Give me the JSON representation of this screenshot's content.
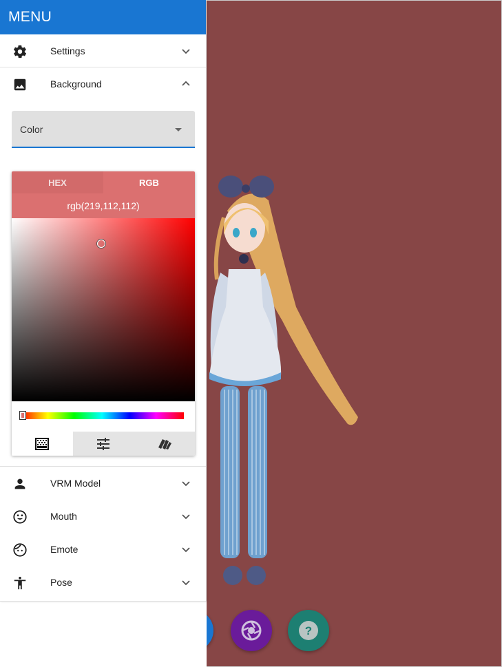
{
  "drawer": {
    "title": "MENU",
    "items": [
      {
        "label": "Settings",
        "icon": "gear-icon"
      },
      {
        "label": "Background",
        "icon": "image-icon",
        "expanded": true
      },
      {
        "label": "VRM Model",
        "icon": "person-icon"
      },
      {
        "label": "Mouth",
        "icon": "smiley-face-icon"
      },
      {
        "label": "Emote",
        "icon": "face-icon"
      },
      {
        "label": "Pose",
        "icon": "accessibility-icon"
      }
    ]
  },
  "background": {
    "select_value": "Color",
    "picker": {
      "tabs": [
        "HEX",
        "RGB"
      ],
      "active_tab": "RGB",
      "readout": "rgb(219,112,112)",
      "modes": [
        "palette-icon",
        "sliders-icon",
        "swatches-icon"
      ],
      "active_mode": "palette-icon"
    }
  },
  "viewport": {
    "background_color": "#874646",
    "buttons": [
      {
        "icon": "camera-shutter-icon",
        "color": "#6a1b9a"
      },
      {
        "icon": "help-icon",
        "color": "#1d7f72"
      }
    ]
  },
  "colors": {
    "primary": "#1976d2",
    "selected_color": "#db7070"
  }
}
